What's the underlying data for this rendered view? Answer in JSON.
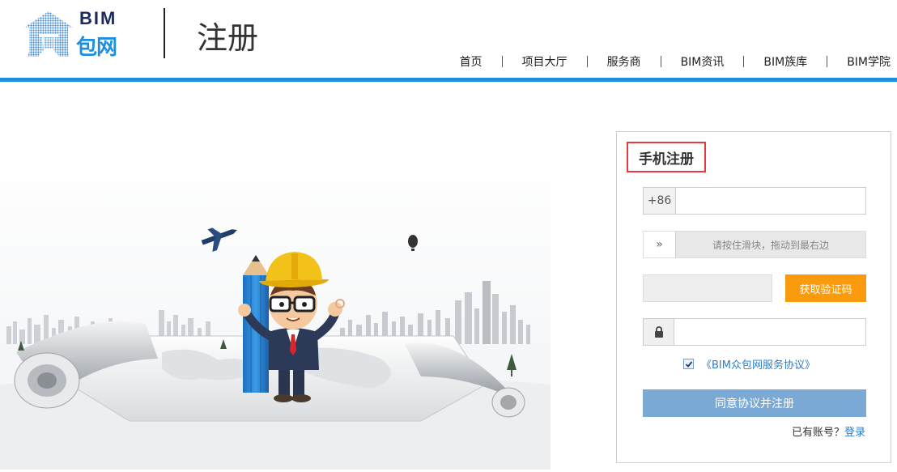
{
  "logo": {
    "line1": "BIM",
    "line2": "包网"
  },
  "page_title": "注册",
  "nav": [
    {
      "label": "首页"
    },
    {
      "label": "项目大厅"
    },
    {
      "label": "服务商"
    },
    {
      "label": "BIM资讯"
    },
    {
      "label": "BIM族库"
    },
    {
      "label": "BIM学院"
    }
  ],
  "register": {
    "title": "手机注册",
    "phone_prefix": "+86",
    "phone_value": "",
    "slider_text": "请按住滑块，拖动到最右边",
    "slider_handle": "»",
    "code_value": "",
    "code_button": "获取验证码",
    "password_value": "",
    "agreement_checked": true,
    "agreement_text": "《BIM众包网服务协议》",
    "submit": "同意协议并注册",
    "have_account": "已有账号？",
    "login": "登录"
  },
  "colors": {
    "accent_blue": "#1e8fe0",
    "orange_button": "#f99b0c",
    "submit_button": "#7ba9d6",
    "title_highlight": "#e8383d",
    "link": "#2f7ec7"
  }
}
